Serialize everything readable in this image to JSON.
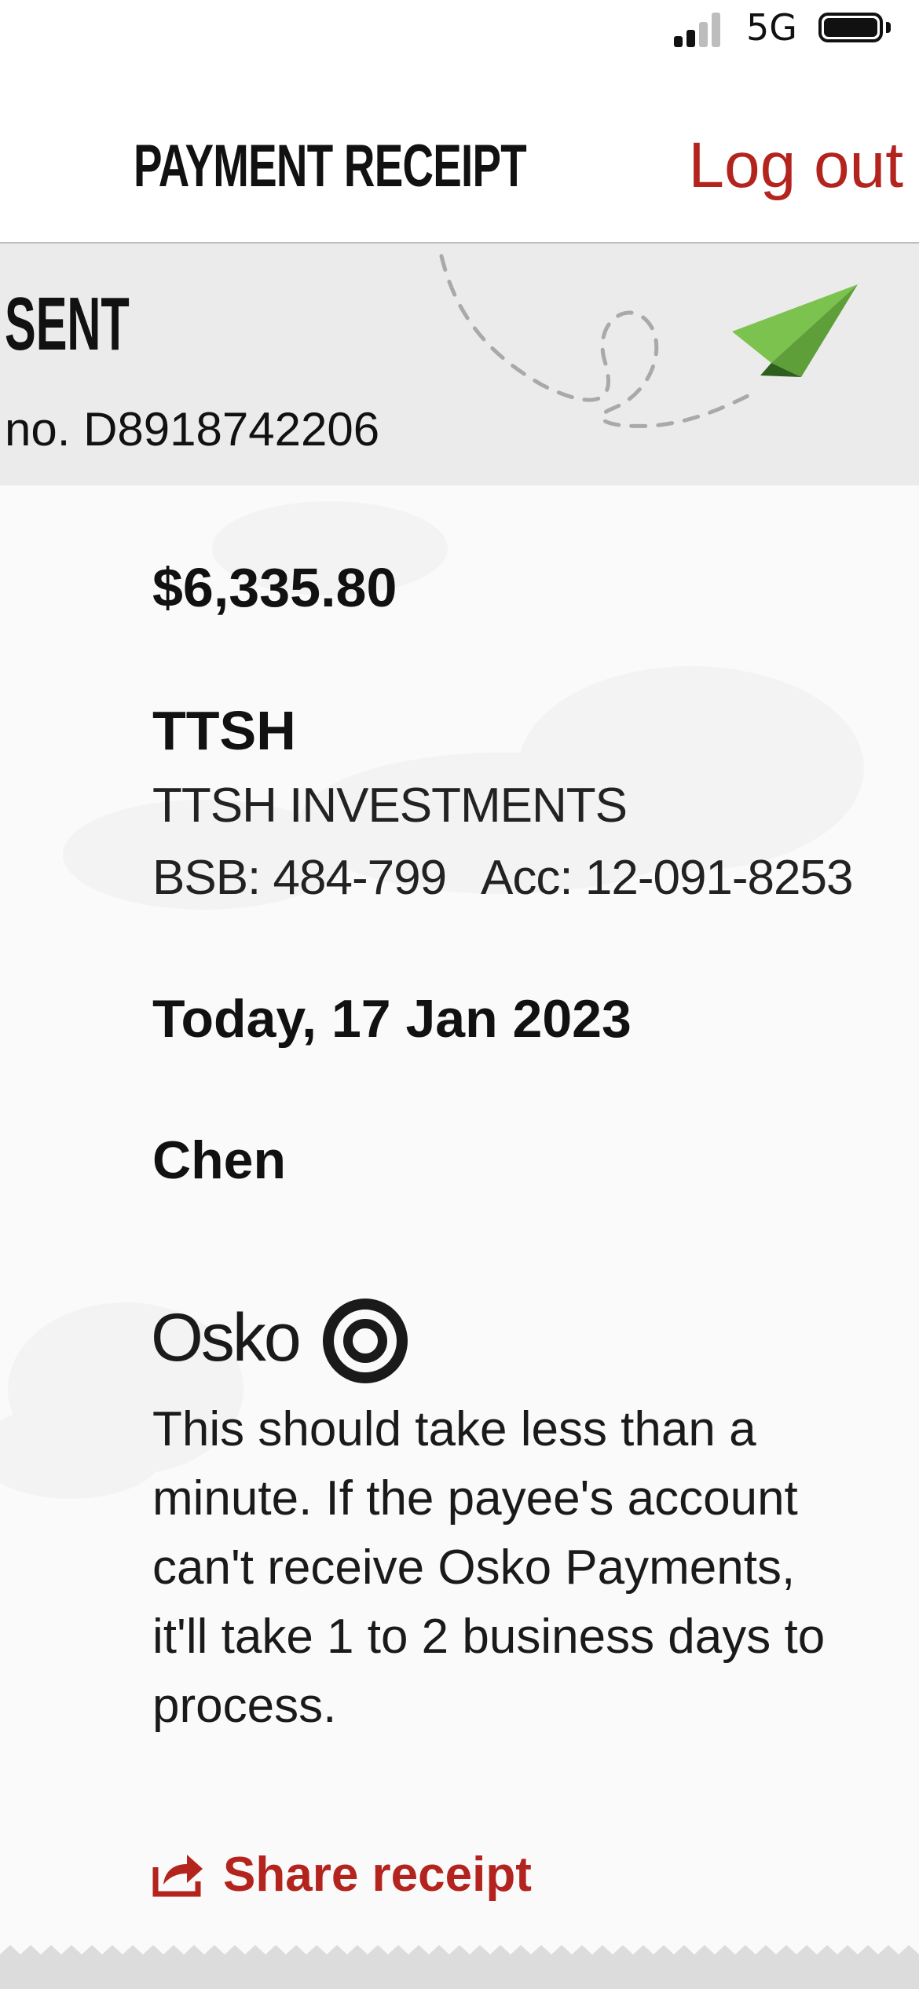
{
  "status_bar": {
    "network": "5G"
  },
  "header": {
    "title": "PAYMENT RECEIPT",
    "logout_label": "Log out"
  },
  "banner": {
    "status": "SENT",
    "reference": "no. D8918742206"
  },
  "payment": {
    "amount": "$6,335.80",
    "payee_nickname": "TTSH",
    "payee_name": "TTSH INVESTMENTS",
    "bsb": "BSB: 484-799",
    "account": "Acc: 12-091-8253",
    "date": "Today, 17 Jan 2023",
    "from": "Chen"
  },
  "osko": {
    "brand": "Osko",
    "message": "This should take less than a minute. If the payee's account can't receive Osko Payments, it'll take 1 to 2 business days to process."
  },
  "actions": {
    "share_label": "Share receipt"
  },
  "colors": {
    "accent": "#b4241f",
    "banner_bg": "#ebebeb",
    "plane_green": "#7cc24e"
  },
  "icons": {
    "signal": "cellular-signal-icon",
    "battery": "battery-icon",
    "plane": "paper-plane-icon",
    "osko": "osko-logo-icon",
    "share": "share-icon"
  }
}
